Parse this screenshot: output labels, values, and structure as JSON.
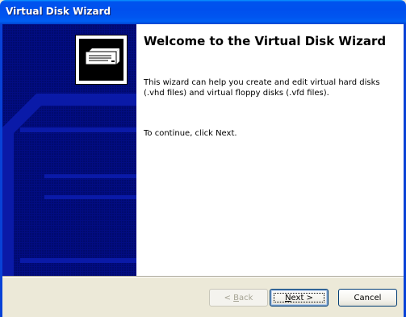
{
  "window": {
    "title": "Virtual Disk Wizard"
  },
  "side_panel": {
    "logo_icon": "virtual-disk-drive-icon"
  },
  "content": {
    "heading": "Welcome to the Virtual Disk Wizard",
    "description": "This wizard can help you create and edit virtual hard disks (.vhd files) and virtual floppy disks (.vfd files).",
    "continue_hint": "To continue, click Next."
  },
  "buttons": {
    "back": {
      "prefix": "< ",
      "mnemonic": "B",
      "rest": "ack",
      "enabled": false
    },
    "next": {
      "mnemonic": "N",
      "rest": "ext >",
      "enabled": true,
      "default": true
    },
    "cancel": {
      "label": "Cancel",
      "enabled": true
    }
  },
  "colors": {
    "title_bar": "#0055ea",
    "side_panel": "#000a6e",
    "content_bg": "#ffffff",
    "dialog_bg": "#ece9d8"
  }
}
